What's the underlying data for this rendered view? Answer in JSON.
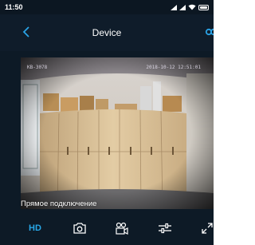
{
  "status_bar": {
    "time": "11:50"
  },
  "header": {
    "title": "Device"
  },
  "video": {
    "osd_left": "KB-3078",
    "osd_right": "2018-10-12 12:51:01",
    "connection_label": "Прямое подключение"
  },
  "toolbar": {
    "hd_label": "HD"
  },
  "colors": {
    "accent": "#28a8e8",
    "background": "#0d1a26"
  }
}
